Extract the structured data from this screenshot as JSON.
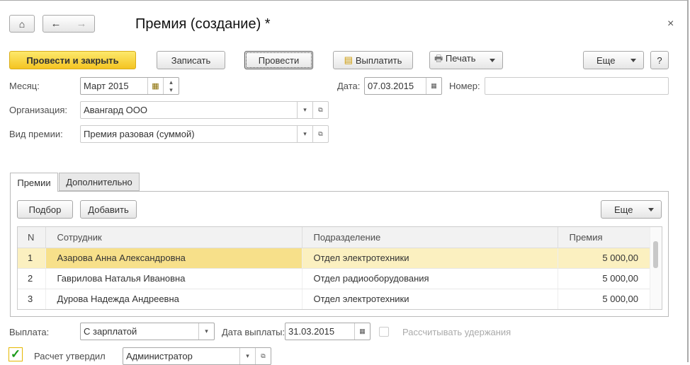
{
  "title": "Премия (создание) *",
  "toolbar": {
    "post_close": "Провести и закрыть",
    "save": "Записать",
    "post": "Провести",
    "pay": "Выплатить",
    "print": "Печать",
    "more": "Еще",
    "help": "?"
  },
  "fields": {
    "month_label": "Месяц:",
    "month": "Март 2015",
    "date_label": "Дата:",
    "date": "07.03.2015",
    "number_label": "Номер:",
    "number": "",
    "org_label": "Организация:",
    "org": "Авангард ООО",
    "kind_label": "Вид премии:",
    "kind": "Премия разовая (суммой)"
  },
  "tabs": [
    {
      "label": "Премии"
    },
    {
      "label": "Дополнительно"
    }
  ],
  "table_toolbar": {
    "pick": "Подбор",
    "add": "Добавить",
    "more": "Еще"
  },
  "table": {
    "headers": [
      "N",
      "Сотрудник",
      "Подразделение",
      "Премия"
    ],
    "rows": [
      [
        "1",
        "Азарова Анна Александровна",
        "Отдел электротехники",
        "5 000,00"
      ],
      [
        "2",
        "Гаврилова Наталья Ивановна",
        "Отдел радиооборудования",
        "5 000,00"
      ],
      [
        "3",
        "Дурова Надежда Андреевна",
        "Отдел электротехники",
        "5 000,00"
      ]
    ]
  },
  "bottom": {
    "payout_label": "Выплата:",
    "payout": "С зарплатой",
    "paydate_label": "Дата выплаты:",
    "paydate": "31.03.2015",
    "withhold_label": "Рассчитывать удержания",
    "approved_label": "Расчет утвердил",
    "approved_by": "Администратор"
  }
}
